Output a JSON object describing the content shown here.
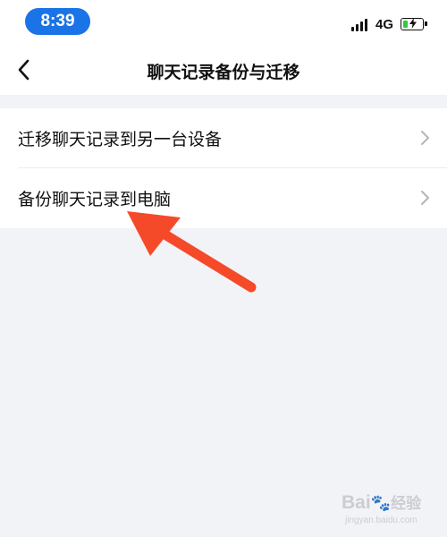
{
  "status_bar": {
    "time": "8:39",
    "network": "4G",
    "battery_level": 0.25,
    "battery_color": "#2ecc40",
    "time_pill_color": "#1b73e8"
  },
  "nav": {
    "back_icon": "chevron-left-icon",
    "title": "聊天记录备份与迁移"
  },
  "menu": {
    "items": [
      {
        "label": "迁移聊天记录到另一台设备",
        "icon": "chevron-right-icon"
      },
      {
        "label": "备份聊天记录到电脑",
        "icon": "chevron-right-icon"
      }
    ]
  },
  "annotation": {
    "arrow_color": "#f44a2a",
    "points_to": "menu.items.1"
  },
  "watermark": {
    "brand": "Bai",
    "brand_suffix": "经验",
    "url": "jingyan.baidu.com"
  }
}
